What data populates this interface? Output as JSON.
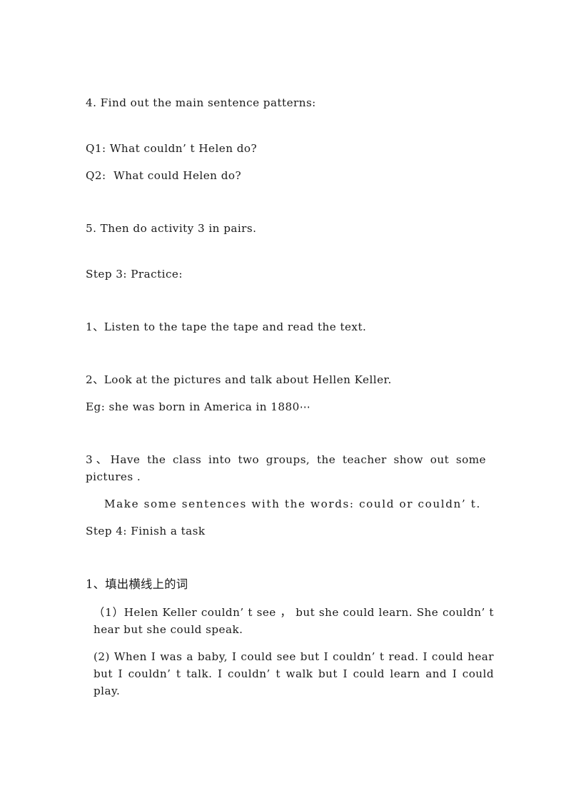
{
  "document": {
    "page_background": "#ffffff",
    "text_color": "#1a1a1a",
    "blocks": [
      {
        "id": "find-patterns",
        "type": "numbered-item",
        "text": "4. Find out the main sentence patterns:"
      },
      {
        "id": "question-1",
        "type": "question",
        "text": "Q1: What couldn’ t Helen do?"
      },
      {
        "id": "question-2",
        "type": "question",
        "text": "Q2:  What could Helen do?"
      },
      {
        "id": "activity-pairs",
        "type": "numbered-item",
        "text": "5. Then do activity 3 in pairs."
      },
      {
        "id": "step-3-heading",
        "type": "step-heading",
        "text": "Step 3: Practice:"
      },
      {
        "id": "practice-1",
        "type": "numbered-item-cjk",
        "text": "1、Listen to the tape the tape and read the text."
      },
      {
        "id": "practice-2",
        "type": "numbered-item-cjk",
        "text": "2、Look at the pictures and talk about Hellen Keller."
      },
      {
        "id": "practice-2-example",
        "type": "example",
        "text": "Eg: she was born in America in 1880⋯"
      },
      {
        "id": "practice-3",
        "type": "numbered-item-cjk-justified",
        "text": "3、Have the class into two groups, the teacher show out some pictures ."
      },
      {
        "id": "practice-3-make",
        "type": "indented-sentence",
        "text": "Make some sentences with the words: could or couldn’ t."
      },
      {
        "id": "step-4-heading",
        "type": "step-heading",
        "text": "Step 4: Finish a task"
      },
      {
        "id": "task-1-heading",
        "type": "cjk-heading",
        "text": "1、填出横线上的词"
      },
      {
        "id": "task-item-1",
        "type": "sub-item-justified",
        "text": "（1）Helen Keller couldn’ t see ， but she could learn. She couldn’ t hear but she could speak."
      },
      {
        "id": "task-item-2",
        "type": "sub-item-justified",
        "text": "(2) When I was a baby, I could see but I couldn’ t read. I could hear but I couldn’ t talk. I couldn’ t walk but I could learn and I could play."
      }
    ]
  }
}
